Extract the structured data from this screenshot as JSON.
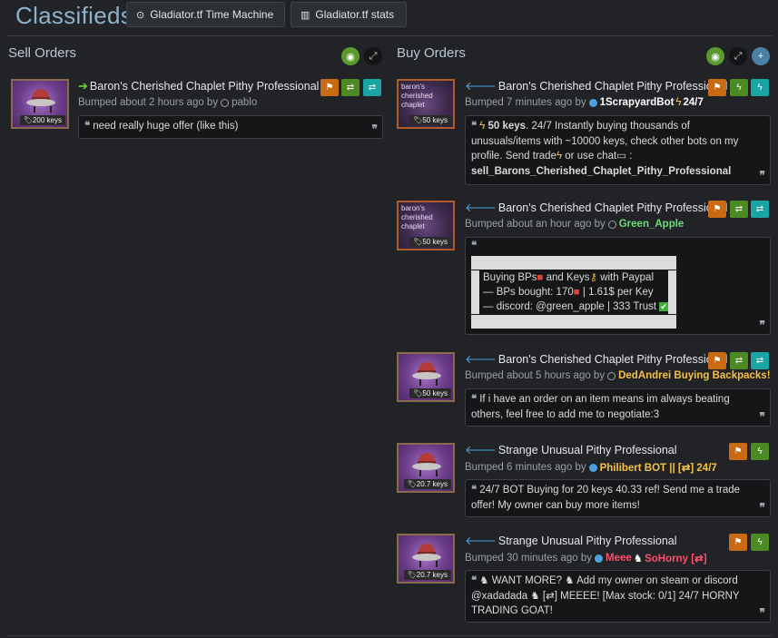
{
  "header": {
    "title": "Classifieds",
    "time_machine_label": "Gladiator.tf Time Machine",
    "stats_label": "Gladiator.tf stats"
  },
  "sell": {
    "heading": "Sell Orders",
    "listings": [
      {
        "title": "Baron's Cherished Chaplet Pithy Professional",
        "price": "200 keys",
        "bumped": "Bumped about 2 hours ago by",
        "user": "pablo",
        "message": "need really huge offer (like this)"
      }
    ]
  },
  "buy": {
    "heading": "Buy Orders",
    "listings": [
      {
        "title": "Baron's Cherished Chaplet Pithy Professional",
        "thumb_text": "baron's cherished chaplet",
        "price": "50 keys",
        "bumped": "Bumped 7 minutes ago by",
        "user": "1ScrapyardBot",
        "user_suffix": "24/7",
        "user_color": "#ffffff",
        "msg_bold": "50 keys",
        "msg_line1": ". 24/7 Instantly buying thousands of",
        "msg_line2": "unusuals/items with ~10000 keys, check other bots on my",
        "msg_line3a": "profile. Send  trade",
        "msg_line3b": " or  use  chat",
        "msg_line3c": " :",
        "msg_line4": "sell_Barons_Cherished_Chaplet_Pithy_Professional"
      },
      {
        "title": "Baron's Cherished Chaplet Pithy Professional",
        "thumb_text": "baron's cherished chaplet",
        "price": "50 keys",
        "bumped": "Bumped about an hour ago by",
        "user": "Green_Apple",
        "user_color": "#6fdc7a",
        "line_a": "Buying BPs",
        "line_a2": " and Keys",
        "line_a3": " with Paypal",
        "line_b": "— BPs bought: 170",
        "line_b2": " | 1.61$ per Key",
        "line_c": "— discord: @green_apple | 333 Trust"
      },
      {
        "title": "Baron's Cherished Chaplet Pithy Professional",
        "price": "50 keys",
        "bumped": "Bumped about 5 hours ago by",
        "user": "DedAndrei Buying Backpacks!",
        "user_color": "#f5c244",
        "msg_line1": "If i have an order on an item means im always beating",
        "msg_line2": "others, feel free to add me to negotiate:3"
      },
      {
        "title": "Strange Unusual Pithy Professional",
        "price": "20.7 keys",
        "bumped": "Bumped 6 minutes ago by",
        "user": "Philibert BOT || [⇄] 24/7",
        "user_color": "#f5c244",
        "msg_line1": "24/7 BOT Buying for 20 keys 40.33 ref! Send me a trade",
        "msg_line2": "offer! My owner can buy more items!"
      },
      {
        "title": "Strange Unusual Pithy Professional",
        "price": "20.7 keys",
        "bumped": "Bumped 30 minutes ago by",
        "user_a": "Meee",
        "user_b": "SoHorny [⇄]",
        "user_color": "#ff4d6d",
        "msg_line1a": " WANT MORE? ",
        "msg_line1b": " Add my owner on steam or discord",
        "msg_line2a": "@xadadada ",
        "msg_line2b": " [⇄] MEEEE! [Max stock: 0/1] 24/7 HORNY",
        "msg_line3": "TRADING GOAT!"
      }
    ]
  },
  "icons": {
    "goat": "🐐",
    "lightning": "⚡",
    "key": "🔑",
    "gift": "🎁",
    "check": "✅",
    "chat": "💬"
  }
}
